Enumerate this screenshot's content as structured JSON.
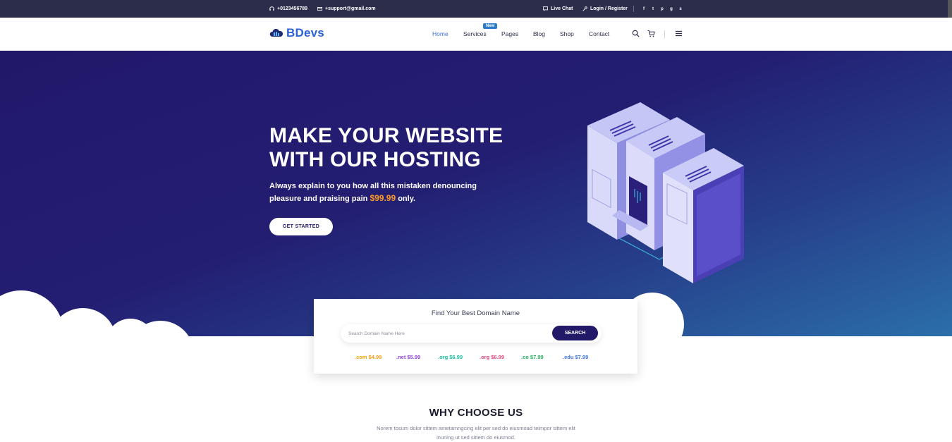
{
  "topbar": {
    "phone": "+0123456789",
    "email": "+support@gmail.com",
    "live_chat": "Live Chat",
    "login": "Login / Register",
    "social_icons": [
      "facebook-icon",
      "twitter-icon",
      "pinterest-icon",
      "google-plus-icon",
      "skype-icon"
    ]
  },
  "navbar": {
    "logo": "BDevs",
    "logo_icon": "cloud-server-icon",
    "links": [
      "Home",
      "Services",
      "Pages",
      "Blog",
      "Shop",
      "Contact"
    ],
    "active_link": "Home",
    "badge": "New",
    "icons": [
      "search-icon",
      "cart-icon",
      "menu-icon"
    ]
  },
  "hero": {
    "title": "MAKE YOUR WEBSITE WITH OUR HOSTING",
    "text_before": "Always explain to you how all this mistaken denouncing pleasure and praising pain ",
    "price": "$99.99",
    "text_after": " only.",
    "cta_label": "GET STARTED",
    "image": "isometric-server-illustration"
  },
  "domain_search": {
    "title": "Find Your Best Domain Name",
    "placeholder": "Search Domain Name Here",
    "button_label": "SEARCH",
    "tlds": [
      {
        "label": ".com $4.99",
        "color": "#f39c12"
      },
      {
        "label": ".net $5.99",
        "color": "#8e44d6"
      },
      {
        "label": ".org $6.99",
        "color": "#1abc9c"
      },
      {
        "label": ".org $6.99",
        "color": "#e0457b"
      },
      {
        "label": ".co $7.99",
        "color": "#27ae60"
      },
      {
        "label": ".edu $7.99",
        "color": "#3b6fd8"
      }
    ]
  },
  "why": {
    "title": "WHY CHOOSE US",
    "text": "Norem tosum dolor sittem ametamngcing elit per sed do eiusmoad teimpor sittem elit inuning ut sed sittem do eiusmod."
  },
  "colors": {
    "topbar_bg": "#2b2d4a",
    "hero_start": "#22186a",
    "hero_end": "#2b6fa8",
    "accent_price": "#ff9a1f",
    "button_dark": "#221a68"
  }
}
